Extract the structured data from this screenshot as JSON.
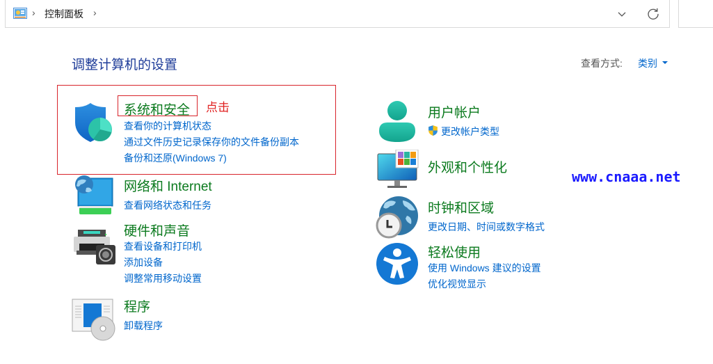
{
  "address_bar": {
    "icon": "control-panel-icon",
    "breadcrumb": [
      "控制面板"
    ],
    "dropdown_icon": "chevron-down-icon",
    "refresh_icon": "refresh-icon"
  },
  "page": {
    "heading": "调整计算机的设置",
    "view_by_label": "查看方式:",
    "view_by_value": "类别"
  },
  "categories_left": [
    {
      "title": "系统和安全",
      "icon": "shield-icon",
      "links": [
        "查看你的计算机状态",
        "通过文件历史记录保存你的文件备份副本",
        "备份和还原(Windows 7)"
      ]
    },
    {
      "title": "网络和 Internet",
      "icon": "network-icon",
      "links": [
        "查看网络状态和任务"
      ]
    },
    {
      "title": "硬件和声音",
      "icon": "printer-icon",
      "links": [
        "查看设备和打印机",
        "添加设备",
        "调整常用移动设置"
      ]
    },
    {
      "title": "程序",
      "icon": "programs-icon",
      "links": [
        "卸载程序"
      ]
    }
  ],
  "categories_right": [
    {
      "title": "用户帐户",
      "icon": "user-icon",
      "links": [
        "更改帐户类型"
      ]
    },
    {
      "title": "外观和个性化",
      "icon": "appearance-icon",
      "links": []
    },
    {
      "title": "时钟和区域",
      "icon": "clock-globe-icon",
      "links": [
        "更改日期、时间或数字格式"
      ]
    },
    {
      "title": "轻松使用",
      "icon": "accessibility-icon",
      "links": [
        "使用 Windows 建议的设置",
        "优化视觉显示"
      ]
    }
  ],
  "annotation": {
    "text": "点击",
    "color": "#e02020"
  },
  "watermark": "www.cnaaa.net",
  "colors": {
    "category_title": "#0b7a1e",
    "link": "#0066cc",
    "heading": "#1f3d99",
    "highlight": "#d8232a"
  }
}
